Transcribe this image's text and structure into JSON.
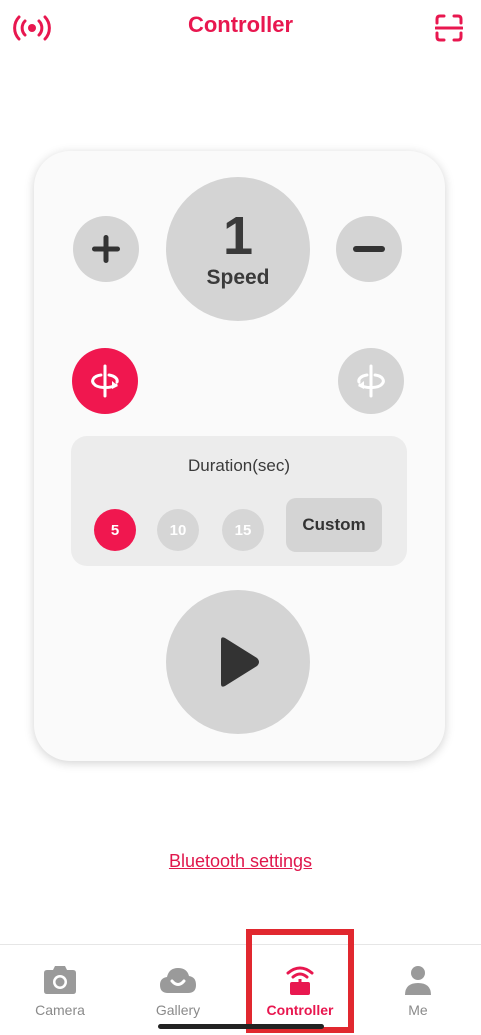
{
  "header": {
    "title": "Controller",
    "left_icon": "broadcast-icon",
    "right_icon": "scan-icon",
    "accent_color": "#e8174f"
  },
  "controller": {
    "speed_value": "1",
    "speed_label": "Speed",
    "plus_icon": "plus-icon",
    "minus_icon": "minus-icon",
    "rotate_left_icon": "rotate-clockwise-icon",
    "rotate_right_icon": "rotate-counterclockwise-icon",
    "rotate_left_active": true,
    "duration": {
      "title": "Duration(sec)",
      "options": [
        "5",
        "10",
        "15"
      ],
      "selected": "5",
      "custom_label": "Custom"
    },
    "play_icon": "play-icon"
  },
  "bluetooth_link": "Bluetooth settings",
  "tabbar": {
    "tabs": [
      {
        "label": "Camera",
        "icon": "camera-icon"
      },
      {
        "label": "Gallery",
        "icon": "cloud-gallery-icon"
      },
      {
        "label": "Controller",
        "icon": "controller-icon"
      },
      {
        "label": "Me",
        "icon": "person-icon"
      }
    ],
    "active": "Controller"
  },
  "colors": {
    "accent": "#f0174f",
    "inactive_gray": "#d4d4d4",
    "highlight": "#e1282f"
  }
}
